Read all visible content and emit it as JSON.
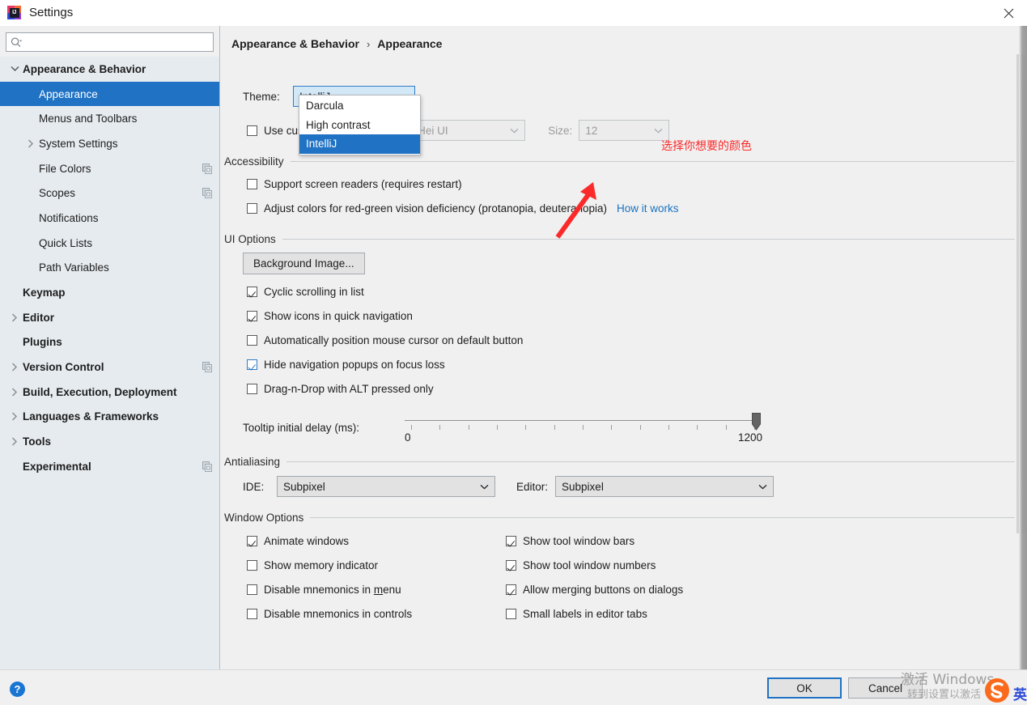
{
  "window": {
    "title": "Settings",
    "logo_icon": "intellij-idea-logo",
    "close_icon": "close-icon"
  },
  "sidebar": {
    "search": {
      "placeholder": "",
      "value": "",
      "icon": "search-icon"
    },
    "items": [
      {
        "label": "Appearance & Behavior",
        "depth": 0,
        "bold": true,
        "arrow": "chevron-down",
        "selected": false,
        "project_icon": false
      },
      {
        "label": "Appearance",
        "depth": 1,
        "bold": false,
        "arrow": "none",
        "selected": true,
        "project_icon": false
      },
      {
        "label": "Menus and Toolbars",
        "depth": 1,
        "bold": false,
        "arrow": "none",
        "selected": false,
        "project_icon": false
      },
      {
        "label": "System Settings",
        "depth": 1,
        "bold": false,
        "arrow": "chevron-right",
        "selected": false,
        "project_icon": false
      },
      {
        "label": "File Colors",
        "depth": 1,
        "bold": false,
        "arrow": "none",
        "selected": false,
        "project_icon": true
      },
      {
        "label": "Scopes",
        "depth": 1,
        "bold": false,
        "arrow": "none",
        "selected": false,
        "project_icon": true
      },
      {
        "label": "Notifications",
        "depth": 1,
        "bold": false,
        "arrow": "none",
        "selected": false,
        "project_icon": false
      },
      {
        "label": "Quick Lists",
        "depth": 1,
        "bold": false,
        "arrow": "none",
        "selected": false,
        "project_icon": false
      },
      {
        "label": "Path Variables",
        "depth": 1,
        "bold": false,
        "arrow": "none",
        "selected": false,
        "project_icon": false
      },
      {
        "label": "Keymap",
        "depth": 0,
        "bold": true,
        "arrow": "none",
        "selected": false,
        "project_icon": false
      },
      {
        "label": "Editor",
        "depth": 0,
        "bold": true,
        "arrow": "chevron-right",
        "selected": false,
        "project_icon": false
      },
      {
        "label": "Plugins",
        "depth": 0,
        "bold": true,
        "arrow": "none",
        "selected": false,
        "project_icon": false
      },
      {
        "label": "Version Control",
        "depth": 0,
        "bold": true,
        "arrow": "chevron-right",
        "selected": false,
        "project_icon": true
      },
      {
        "label": "Build, Execution, Deployment",
        "depth": 0,
        "bold": true,
        "arrow": "chevron-right",
        "selected": false,
        "project_icon": false
      },
      {
        "label": "Languages & Frameworks",
        "depth": 0,
        "bold": true,
        "arrow": "chevron-right",
        "selected": false,
        "project_icon": false
      },
      {
        "label": "Tools",
        "depth": 0,
        "bold": true,
        "arrow": "chevron-right",
        "selected": false,
        "project_icon": false
      },
      {
        "label": "Experimental",
        "depth": 0,
        "bold": true,
        "arrow": "none",
        "selected": false,
        "project_icon": true
      }
    ]
  },
  "breadcrumb": {
    "parent": "Appearance & Behavior",
    "separator": "›",
    "current": "Appearance"
  },
  "theme_row": {
    "label": "Theme:",
    "selected_value": "IntelliJ",
    "options": [
      "Darcula",
      "High contrast",
      "IntelliJ"
    ],
    "highlighted_option": "IntelliJ"
  },
  "font_row": {
    "checkbox_label": "Use custom font:",
    "checkbox_label_visible": "Use cu",
    "checked": false,
    "font_value": "Microsoft YaHei UI",
    "font_value_visible": "oft YaHei UI",
    "size_label": "Size:",
    "size_value": "12",
    "disabled": true
  },
  "annotation": {
    "text": "选择你想要的颜色",
    "color": "#fb2a2a",
    "arrow_icon": "red-arrow-pointing-up-right"
  },
  "accessibility": {
    "section_title": "Accessibility",
    "items": [
      {
        "label": "Support screen readers (requires restart)",
        "checked": false
      },
      {
        "label": "Adjust colors for red-green vision deficiency (protanopia, deuteranopia)",
        "checked": false
      }
    ],
    "link": "How it works",
    "link_color": "#1a72c0"
  },
  "ui_options": {
    "section_title": "UI Options",
    "background_image_button": "Background Image...",
    "items": [
      {
        "label": "Cyclic scrolling in list",
        "checked": true,
        "focus": false
      },
      {
        "label": "Show icons in quick navigation",
        "checked": true,
        "focus": false
      },
      {
        "label": "Automatically position mouse cursor on default button",
        "checked": false,
        "focus": false
      },
      {
        "label": "Hide navigation popups on focus loss",
        "checked": true,
        "focus": true
      },
      {
        "label": "Drag-n-Drop with ALT pressed only",
        "checked": false,
        "focus": false
      }
    ],
    "slider": {
      "label": "Tooltip initial delay (ms):",
      "min_label": "0",
      "max_label": "1200",
      "min": 0,
      "max": 1200,
      "value": 1200,
      "ticks": 13
    }
  },
  "antialiasing": {
    "section_title": "Antialiasing",
    "ide_label": "IDE:",
    "ide_value": "Subpixel",
    "editor_label": "Editor:",
    "editor_value": "Subpixel"
  },
  "window_options": {
    "section_title": "Window Options",
    "left_column": [
      {
        "label": "Animate windows",
        "checked": true
      },
      {
        "label": "Show memory indicator",
        "checked": false
      },
      {
        "label": "Disable mnemonics in menu",
        "checked": false,
        "mnemonic": "m"
      },
      {
        "label": "Disable mnemonics in controls",
        "checked": false
      }
    ],
    "right_column": [
      {
        "label": "Show tool window bars",
        "checked": true
      },
      {
        "label": "Show tool window numbers",
        "checked": true
      },
      {
        "label": "Allow merging buttons on dialogs",
        "checked": true
      },
      {
        "label": "Small labels in editor tabs",
        "checked": false
      }
    ]
  },
  "footer": {
    "help_icon": "help-question-icon",
    "help_label": "?",
    "ok_label": "OK",
    "cancel_label": "Cancel"
  },
  "overlay": {
    "watermark_line1": "激活 Windows",
    "watermark_line2": "转到设置以激活",
    "ime_icon": "sogou-ime-icon",
    "ime_mode": "英"
  },
  "colors": {
    "accent_blue": "#1f72c4",
    "selection_blue": "#1f72c4",
    "combo_focus_fill": "#d3e8f7",
    "sidebar_bg": "#e6ebef",
    "pane_bg": "#f0f0f0",
    "annotation_red": "#fb2a2a",
    "link_blue": "#1a72c0"
  }
}
